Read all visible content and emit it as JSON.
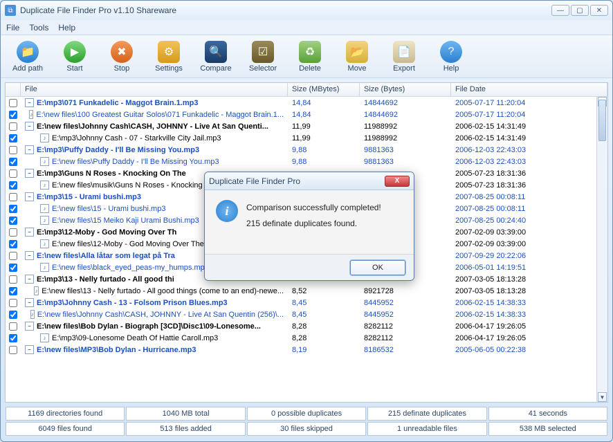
{
  "window": {
    "title": "Duplicate File Finder Pro v1.10 Shareware"
  },
  "menu": {
    "file": "File",
    "tools": "Tools",
    "help": "Help"
  },
  "toolbar": {
    "addpath": "Add path",
    "start": "Start",
    "stop": "Stop",
    "settings": "Settings",
    "compare": "Compare",
    "selector": "Selector",
    "delete": "Delete",
    "move": "Move",
    "export": "Export",
    "help": "Help"
  },
  "columns": {
    "file": "File",
    "smb": "Size (MBytes)",
    "sb": "Size (Bytes)",
    "date": "File Date"
  },
  "rows": [
    {
      "checked": false,
      "dup": true,
      "bold": true,
      "indent": false,
      "file": "E:\\mp3\\071 Funkadelic - Maggot Brain.1.mp3",
      "smb": "14,84",
      "sb": "14844692",
      "date": "2005-07-17 11:20:04"
    },
    {
      "checked": true,
      "dup": true,
      "bold": false,
      "indent": true,
      "file": "E:\\new files\\100 Greatest Guitar Solos\\071 Funkadelic - Maggot Brain.1...",
      "smb": "14,84",
      "sb": "14844692",
      "date": "2005-07-17 11:20:04"
    },
    {
      "checked": false,
      "dup": false,
      "bold": true,
      "indent": false,
      "file": "E:\\new files\\Johnny Cash\\CASH, JOHNNY - Live At San Quenti...",
      "smb": "11,99",
      "sb": "11988992",
      "date": "2006-02-15 14:31:49"
    },
    {
      "checked": true,
      "dup": false,
      "bold": false,
      "indent": true,
      "file": "E:\\mp3\\Johnny Cash - 07 - Starkville City Jail.mp3",
      "smb": "11,99",
      "sb": "11988992",
      "date": "2006-02-15 14:31:49"
    },
    {
      "checked": false,
      "dup": true,
      "bold": true,
      "indent": false,
      "file": "E:\\mp3\\Puffy Daddy - I'll Be Missing You.mp3",
      "smb": "9,88",
      "sb": "9881363",
      "date": "2006-12-03 22:43:03"
    },
    {
      "checked": true,
      "dup": true,
      "bold": false,
      "indent": true,
      "file": "E:\\new files\\Puffy Daddy - I'll Be Missing You.mp3",
      "smb": "9,88",
      "sb": "9881363",
      "date": "2006-12-03 22:43:03"
    },
    {
      "checked": false,
      "dup": false,
      "bold": true,
      "indent": false,
      "file": "E:\\mp3\\Guns N Roses - Knocking On The",
      "smb": "",
      "sb": "",
      "date": "2005-07-23 18:31:36"
    },
    {
      "checked": true,
      "dup": false,
      "bold": false,
      "indent": true,
      "file": "E:\\new files\\musik\\Guns N Roses - Knocking O",
      "smb": "",
      "sb": "",
      "date": "2005-07-23 18:31:36"
    },
    {
      "checked": false,
      "dup": true,
      "bold": true,
      "indent": false,
      "file": "E:\\mp3\\15 - Urami bushi.mp3",
      "smb": "",
      "sb": "",
      "date": "2007-08-25 00:08:11"
    },
    {
      "checked": true,
      "dup": true,
      "bold": false,
      "indent": true,
      "file": "E:\\new files\\15 - Urami bushi.mp3",
      "smb": "",
      "sb": "",
      "date": "2007-08-25 00:08:11"
    },
    {
      "checked": true,
      "dup": true,
      "bold": false,
      "indent": true,
      "file": "E:\\new files\\15 Meiko Kaji Urami Bushi.mp3",
      "smb": "",
      "sb": "",
      "date": "2007-08-25 00:24:40"
    },
    {
      "checked": false,
      "dup": false,
      "bold": true,
      "indent": false,
      "file": "E:\\mp3\\12-Moby - God Moving Over Th",
      "smb": "",
      "sb": "",
      "date": "2007-02-09 03:39:00"
    },
    {
      "checked": true,
      "dup": false,
      "bold": false,
      "indent": true,
      "file": "E:\\new files\\12-Moby - God Moving Over The F",
      "smb": "",
      "sb": "",
      "date": "2007-02-09 03:39:00"
    },
    {
      "checked": false,
      "dup": true,
      "bold": true,
      "indent": false,
      "file": "E:\\new files\\Alla låtar som legat på Tra",
      "smb": "",
      "sb": "",
      "date": "2007-09-29 20:22:06"
    },
    {
      "checked": true,
      "dup": true,
      "bold": false,
      "indent": true,
      "file": "E:\\new files\\black_eyed_peas-my_humps.mp3",
      "smb": "",
      "sb": "",
      "date": "2006-05-01 14:19:51"
    },
    {
      "checked": false,
      "dup": false,
      "bold": true,
      "indent": false,
      "file": "E:\\mp3\\13 - Nelly furtado - All good thi",
      "smb": "",
      "sb": "",
      "date": "2007-03-05 18:13:28"
    },
    {
      "checked": true,
      "dup": false,
      "bold": false,
      "indent": true,
      "file": "E:\\new files\\13 - Nelly furtado - All good things (come to an end)-newe...",
      "smb": "8,52",
      "sb": "8921728",
      "date": "2007-03-05 18:13:28"
    },
    {
      "checked": false,
      "dup": true,
      "bold": true,
      "indent": false,
      "file": "E:\\mp3\\Johnny Cash - 13 - Folsom Prison Blues.mp3",
      "smb": "8,45",
      "sb": "8445952",
      "date": "2006-02-15 14:38:33"
    },
    {
      "checked": true,
      "dup": true,
      "bold": false,
      "indent": true,
      "file": "E:\\new files\\Johnny Cash\\CASH, JOHNNY - Live At San Quentin  (256)\\...",
      "smb": "8,45",
      "sb": "8445952",
      "date": "2006-02-15 14:38:33"
    },
    {
      "checked": false,
      "dup": false,
      "bold": true,
      "indent": false,
      "file": "E:\\new files\\Bob Dylan - Biograph [3CD]\\Disc1\\09-Lonesome...",
      "smb": "8,28",
      "sb": "8282112",
      "date": "2006-04-17 19:26:05"
    },
    {
      "checked": true,
      "dup": false,
      "bold": false,
      "indent": true,
      "file": "E:\\mp3\\09-Lonesome Death Of Hattie Caroll.mp3",
      "smb": "8,28",
      "sb": "8282112",
      "date": "2006-04-17 19:26:05"
    },
    {
      "checked": false,
      "dup": true,
      "bold": true,
      "indent": false,
      "file": "E:\\new files\\MP3\\Bob Dylan - Hurricane.mp3",
      "smb": "8,19",
      "sb": "8186532",
      "date": "2005-06-05 00:22:38"
    }
  ],
  "status": {
    "r1": [
      "1169 directories found",
      "1040 MB total",
      "0 possible duplicates",
      "215 definate duplicates",
      "41 seconds"
    ],
    "r2": [
      "6049 files found",
      "513 files added",
      "30 files skipped",
      "1 unreadable files",
      "538 MB selected"
    ]
  },
  "dialog": {
    "title": "Duplicate File Finder Pro",
    "line1": "Comparison successfully completed!",
    "line2": "215 definate duplicates found.",
    "ok": "OK"
  }
}
